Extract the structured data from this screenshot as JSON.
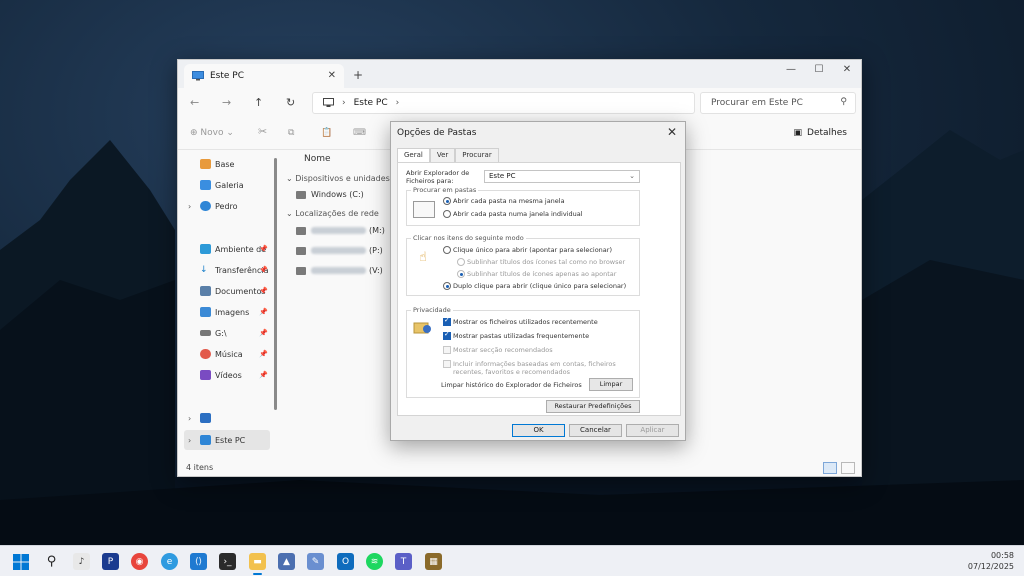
{
  "explorer": {
    "tab_title": "Este PC",
    "new_tab": "+",
    "address_path": "Este PC",
    "search_placeholder": "Procurar em Este PC",
    "toolbar": {
      "new_label": "Novo",
      "details_label": "Detalhes"
    },
    "sidebar": {
      "items": [
        {
          "label": "Base",
          "icon": "home-icon"
        },
        {
          "label": "Galeria",
          "icon": "gallery-icon"
        },
        {
          "label": "Pedro",
          "icon": "onedrive-icon"
        },
        {
          "label": "Ambiente de",
          "icon": "desktop-icon"
        },
        {
          "label": "Transferência",
          "icon": "download-icon"
        },
        {
          "label": "Documentos",
          "icon": "documents-icon"
        },
        {
          "label": "Imagens",
          "icon": "images-icon"
        },
        {
          "label": "G:\\",
          "icon": "drive-icon"
        },
        {
          "label": "Música",
          "icon": "music-icon"
        },
        {
          "label": "Vídeos",
          "icon": "videos-icon"
        },
        {
          "label": "Este PC",
          "icon": "computer-icon"
        }
      ]
    },
    "content": {
      "column_name": "Nome",
      "group_devices": "Dispositivos e unidades",
      "drive_c": "Windows (C:)",
      "group_network": "Localizações de rede",
      "net_drive_m": "(M:)",
      "net_drive_p": "(P:)",
      "net_drive_v": "(V:)"
    },
    "status": "4 itens"
  },
  "dialog": {
    "title": "Opções de Pastas",
    "tabs": [
      "Geral",
      "Ver",
      "Procurar"
    ],
    "open_explorer_label": "Abrir Explorador de Ficheiros para:",
    "open_explorer_value": "Este PC",
    "browse_group": "Procurar em pastas",
    "browse_same": "Abrir cada pasta na mesma janela",
    "browse_own": "Abrir cada pasta numa janela individual",
    "click_group": "Clicar nos itens do seguinte modo",
    "single_click": "Clique único para abrir (apontar para selecionar)",
    "underline_browser": "Sublinhar títulos dos ícones tal como no browser",
    "underline_point": "Sublinhar títulos de ícones apenas ao apontar",
    "double_click": "Duplo clique para abrir (clique único para selecionar)",
    "privacy_group": "Privacidade",
    "show_recent_files": "Mostrar os ficheiros utilizados recentemente",
    "show_frequent_folders": "Mostrar pastas utilizadas frequentemente",
    "show_recommended": "Mostrar secção recomendados",
    "include_online": "Incluir informações baseadas em contas, ficheiros recentes, favoritos e recomendados",
    "clear_history_label": "Limpar histórico do Explorador de Ficheiros",
    "clear_button": "Limpar",
    "restore_defaults": "Restaurar Predefinições",
    "ok": "OK",
    "cancel": "Cancelar",
    "apply": "Aplicar"
  },
  "taskbar": {
    "time": "00:58",
    "date": "07/12/2025",
    "icons": [
      "windows-start-icon",
      "search-icon",
      "audio-icon",
      "pandora-icon",
      "chrome-icon",
      "edge-icon",
      "vscode-icon",
      "terminal-icon",
      "file-explorer-icon",
      "photos-icon",
      "paint-icon",
      "outlook-icon",
      "spotify-icon",
      "teams-icon",
      "store-icon"
    ]
  }
}
